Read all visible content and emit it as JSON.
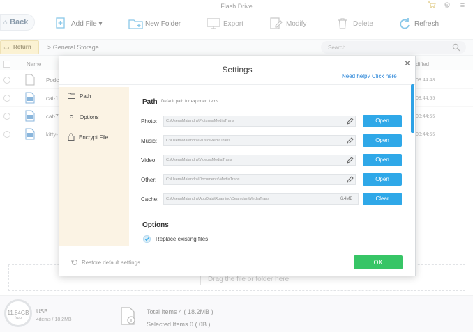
{
  "window": {
    "title": "Flash Drive"
  },
  "toolbar": {
    "back_label": "Back",
    "add_file_label": "Add File ▾",
    "new_folder_label": "New Folder",
    "export_label": "Export",
    "modify_label": "Modify",
    "delete_label": "Delete",
    "refresh_label": "Refresh"
  },
  "nav": {
    "return_label": "Return",
    "breadcrumb": "> General Storage",
    "search_placeholder": "Search"
  },
  "table": {
    "col_name": "Name",
    "col_modified": "dified",
    "rows": [
      {
        "name": "Podc",
        "time": "08:44:48"
      },
      {
        "name": "cat-1",
        "time": "08:44:55"
      },
      {
        "name": "cat-7",
        "time": "08:44:55"
      },
      {
        "name": "kitty-",
        "time": "08:44:55"
      }
    ]
  },
  "drop_area": {
    "text": "Drag the file or folder here"
  },
  "footer": {
    "storage_size": "11.84GB",
    "storage_free": "free",
    "device_label": "USB",
    "device_detail": "4items / 18.2MB",
    "total_items": "Total Items 4 ( 18.2MB )",
    "selected_items": "Selected Items 0 ( 0B )"
  },
  "dialog": {
    "title": "Settings",
    "help_link": "Need help? Click here",
    "sidebar": [
      {
        "label": "Path"
      },
      {
        "label": "Options"
      },
      {
        "label": "Encrypt File"
      }
    ],
    "path_section": {
      "heading": "Path",
      "subheading": "Default path for exported items",
      "items": [
        {
          "label": "Photo:",
          "value": "C:\\Users\\Malandra\\Pictures\\MediaTrans",
          "button": "Open"
        },
        {
          "label": "Music:",
          "value": "C:\\Users\\Malandra\\Music\\MediaTrans",
          "button": "Open"
        },
        {
          "label": "Video:",
          "value": "C:\\Users\\Malandra\\Videos\\MediaTrans",
          "button": "Open"
        },
        {
          "label": "Other:",
          "value": "C:\\Users\\Malandra\\Documents\\MediaTrans",
          "button": "Open"
        },
        {
          "label": "Cache:",
          "value": "C:\\Users\\Malandra\\AppData\\Roaming\\Deamdan\\MediaTrans",
          "button": "Clear"
        }
      ],
      "cache_size": "6.4MB"
    },
    "options_section": {
      "heading": "Options",
      "replace_label": "Replace existing files"
    },
    "restore_label": "Restore default settings",
    "ok_label": "OK"
  },
  "colors": {
    "accent_blue": "#2fa8e8",
    "ok_green": "#37c566",
    "sidebar_bg": "#fbf3e4",
    "return_yellow": "#f7e7b0",
    "link_blue": "#1f7fd6"
  }
}
